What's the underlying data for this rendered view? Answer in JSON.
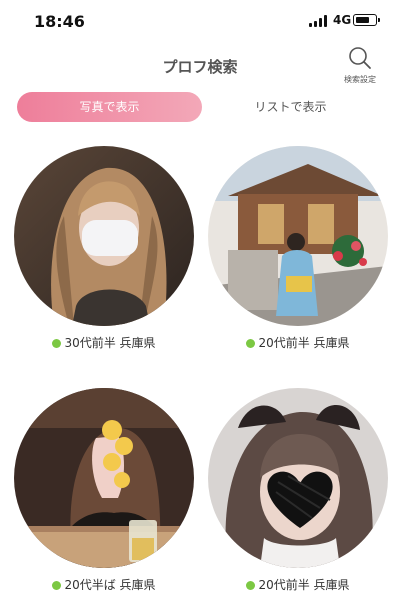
{
  "status_bar": {
    "time": "18:46",
    "network": "4G",
    "battery_level": 0.7
  },
  "header": {
    "title": "プロフ検索",
    "search_settings_label": "検索設定"
  },
  "tabs": [
    {
      "label": "写真で表示",
      "active": true
    },
    {
      "label": "リストで表示",
      "active": false
    }
  ],
  "profiles": [
    {
      "age": "30代前半",
      "location": "兵庫県",
      "online": true
    },
    {
      "age": "20代前半",
      "location": "兵庫県",
      "online": true
    },
    {
      "age": "20代半ば",
      "location": "兵庫県",
      "online": true
    },
    {
      "age": "20代前半",
      "location": "兵庫県",
      "online": true
    }
  ],
  "colors": {
    "accent": "#ee7e9a",
    "online": "#7cc843"
  }
}
